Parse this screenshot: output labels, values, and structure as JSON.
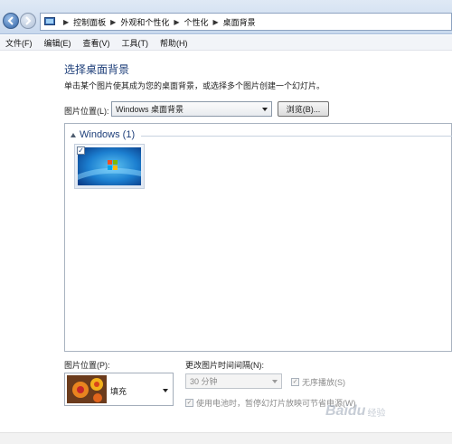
{
  "breadcrumb": {
    "items": [
      "控制面板",
      "外观和个性化",
      "个性化",
      "桌面背景"
    ]
  },
  "menu": {
    "items": [
      "文件(F)",
      "编辑(E)",
      "查看(V)",
      "工具(T)",
      "帮助(H)"
    ]
  },
  "page": {
    "title": "选择桌面背景",
    "subtitle": "单击某个图片使其成为您的桌面背景，或选择多个图片创建一个幻灯片。"
  },
  "location": {
    "label": "图片位置(L):",
    "value": "Windows 桌面背景",
    "browse_label": "浏览(B)..."
  },
  "gallery": {
    "group_name": "Windows (1)",
    "items": [
      {
        "checked": true,
        "check_glyph": "✓"
      }
    ]
  },
  "position": {
    "label": "图片位置(P):",
    "value": "填充"
  },
  "interval": {
    "label": "更改图片时间间隔(N):",
    "value": "30 分钟"
  },
  "options": {
    "shuffle_label": "无序播放(S)",
    "shuffle_glyph": "✓",
    "battery_label": "使用电池时，暂停幻灯片放映可节省电源(W)",
    "battery_glyph": "✓"
  },
  "watermark": {
    "text": "Baidu",
    "sub": "经验"
  },
  "colors": {
    "title": "#1e3f7a",
    "disabled_text": "#8a8a8a"
  }
}
